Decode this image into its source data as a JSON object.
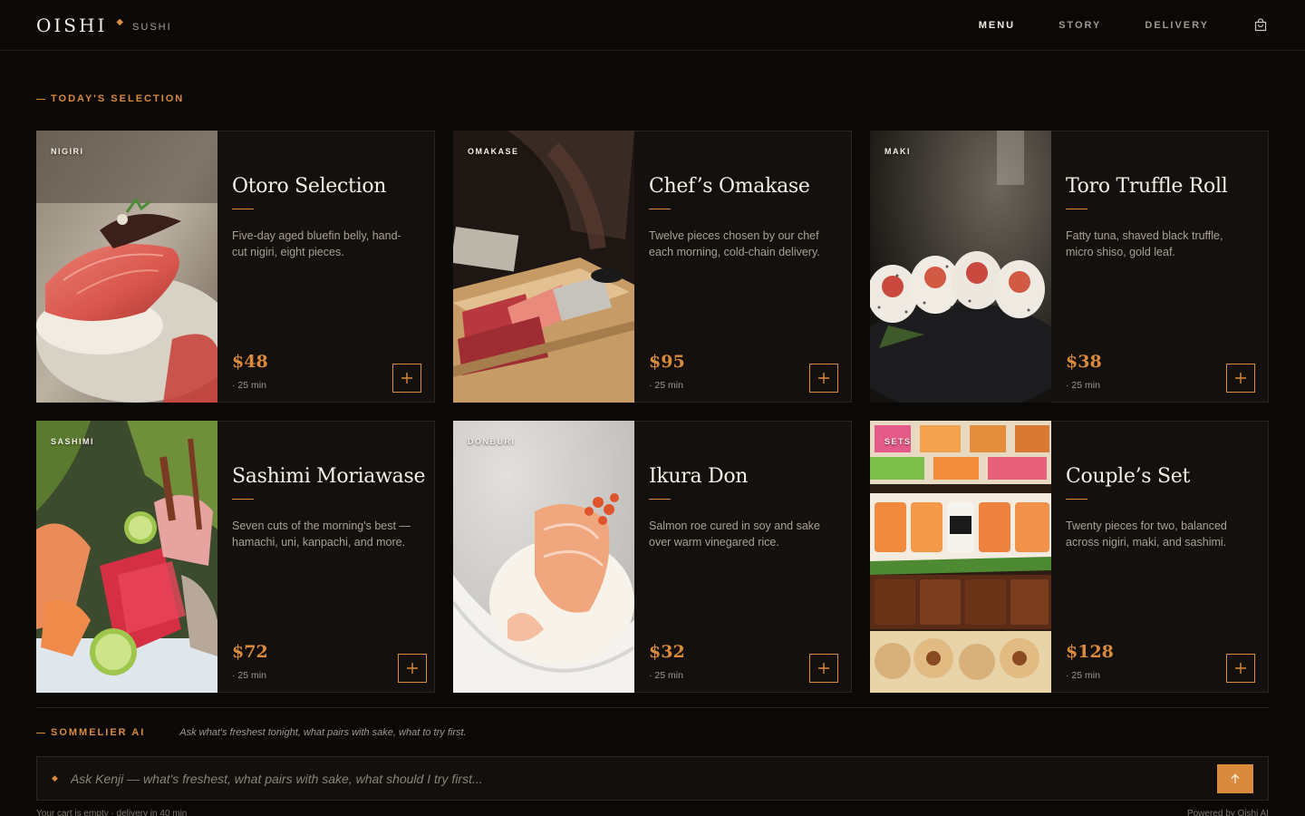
{
  "header": {
    "brand_name": "OISHI",
    "brand_sub": "SUSHI",
    "nav": [
      {
        "label": "MENU",
        "active": true
      },
      {
        "label": "STORY",
        "active": false
      },
      {
        "label": "DELIVERY",
        "active": false
      }
    ],
    "cart_icon": "shopping-bag-icon"
  },
  "section": {
    "eyebrow": "TODAY'S SELECTION"
  },
  "items": [
    {
      "tag": "NIGIRI",
      "title": "Otoro Selection",
      "desc": "Five-day aged bluefin belly, hand-cut nigiri, eight pieces.",
      "price": "$48",
      "time": "· 25 min"
    },
    {
      "tag": "OMAKASE",
      "title": "Chef’s Omakase",
      "desc": "Twelve pieces chosen by our chef each morning, cold-chain delivery.",
      "price": "$95",
      "time": "· 25 min"
    },
    {
      "tag": "MAKI",
      "title": "Toro Truffle Roll",
      "desc": "Fatty tuna, shaved black truffle, micro shiso, gold leaf.",
      "price": "$38",
      "time": "· 25 min"
    },
    {
      "tag": "SASHIMI",
      "title": "Sashimi Moriawase",
      "desc": "Seven cuts of the morning's best — hamachi, uni, kanpachi, and more.",
      "price": "$72",
      "time": "· 25 min"
    },
    {
      "tag": "DONBURI",
      "title": "Ikura Don",
      "desc": "Salmon roe cured in soy and sake over warm vinegared rice.",
      "price": "$32",
      "time": "· 25 min"
    },
    {
      "tag": "SETS",
      "title": "Couple’s Set",
      "desc": "Twenty pieces for two, balanced across nigiri, maki, and sashimi.",
      "price": "$128",
      "time": "· 25 min"
    }
  ],
  "ai": {
    "label": "SOMMELIER AI",
    "hint": "Ask what's freshest tonight, what pairs with sake, what to try first.",
    "placeholder": "Ask Kenji — what's freshest, what pairs with sake, what should I try first...",
    "value": ""
  },
  "footer": {
    "left": "Your cart is empty · delivery in 40 min",
    "right": "Powered by Oishi AI"
  },
  "colors": {
    "accent": "#d98a3c",
    "background": "#0a0908",
    "card": "#13100d"
  }
}
